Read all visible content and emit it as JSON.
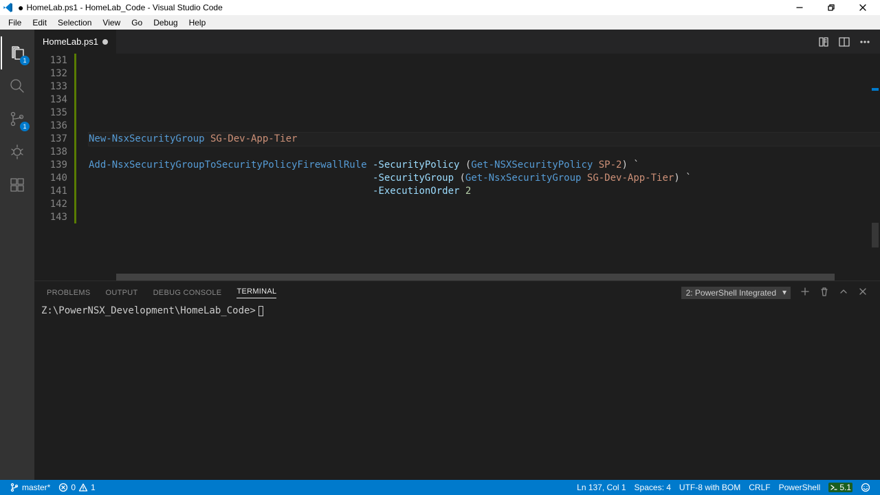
{
  "window": {
    "modified_dot": "●",
    "title": "HomeLab.ps1 - HomeLab_Code - Visual Studio Code"
  },
  "menu": [
    "File",
    "Edit",
    "Selection",
    "View",
    "Go",
    "Debug",
    "Help"
  ],
  "activity": {
    "explorer_badge": "1",
    "scm_badge": "1"
  },
  "tab": {
    "name": "HomeLab.ps1"
  },
  "editor": {
    "line_start": 131,
    "lines": [
      "",
      "",
      "",
      "",
      "",
      "",
      "",
      "",
      "",
      "",
      "",
      "",
      ""
    ],
    "code": {
      "l137_cmd": "New-NsxSecurityGroup",
      "l137_arg": " SG-Dev-App-Tier",
      "l139_cmd": "Add-NsxSecurityGroupToSecurityPolicyFirewallRule",
      "l139_p1": " -SecurityPolicy",
      "l139_paren1": " (",
      "l139_cmd2": "Get-NSXSecurityPolicy",
      "l139_arg2": " SP-2",
      "l139_paren2": ")",
      "l139_cont": " `",
      "l140_indent": "                                                 ",
      "l140_p1": "-SecurityGroup",
      "l140_paren1": " (",
      "l140_cmd2": "Get-NsxSecurityGroup",
      "l140_arg2": " SG-Dev-App-Tier",
      "l140_paren2": ")",
      "l140_cont": " `",
      "l141_indent": "                                                 ",
      "l141_p1": "-ExecutionOrder",
      "l141_num": " 2"
    }
  },
  "panel": {
    "tabs": [
      "PROBLEMS",
      "OUTPUT",
      "DEBUG CONSOLE",
      "TERMINAL"
    ],
    "active_tab": 3,
    "terminal_select": "2: PowerShell Integrated",
    "prompt": "Z:\\PowerNSX_Development\\HomeLab_Code>"
  },
  "status": {
    "branch": "master*",
    "errors": "0",
    "warnings": "1",
    "position": "Ln 137, Col 1",
    "spaces": "Spaces: 4",
    "encoding": "UTF-8 with BOM",
    "eol": "CRLF",
    "lang": "PowerShell",
    "ps_version": "5.1"
  }
}
